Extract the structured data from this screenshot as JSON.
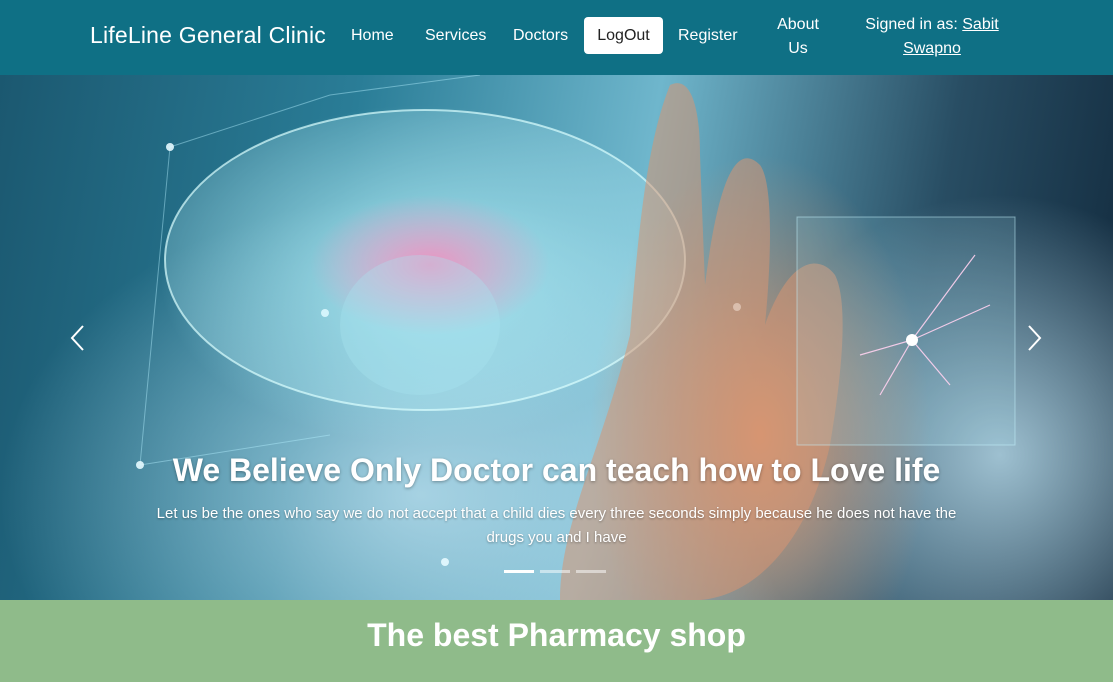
{
  "navbar": {
    "brand": "LifeLine General Clinic",
    "links": {
      "home": "Home",
      "services": "Services",
      "doctors": "Doctors",
      "logout": "LogOut",
      "register": "Register",
      "about_line1": "About",
      "about_line2": "Us"
    },
    "signed_in": {
      "label": "Signed in as:",
      "user_first": "Sabit",
      "user_last": "Swapno"
    },
    "color": "#0f7085"
  },
  "carousel": {
    "title": "We Believe Only Doctor can teach how to Love life",
    "text": "Let us be the ones who say we do not accept that a child dies every three seconds simply because he does not have the drugs you and I have",
    "prev_icon": "chevron-left-icon",
    "next_icon": "chevron-right-icon",
    "slide_count": 3,
    "active_index": 0
  },
  "pharmacy": {
    "title": "The best Pharmacy shop",
    "background": "#8fbb8a"
  }
}
